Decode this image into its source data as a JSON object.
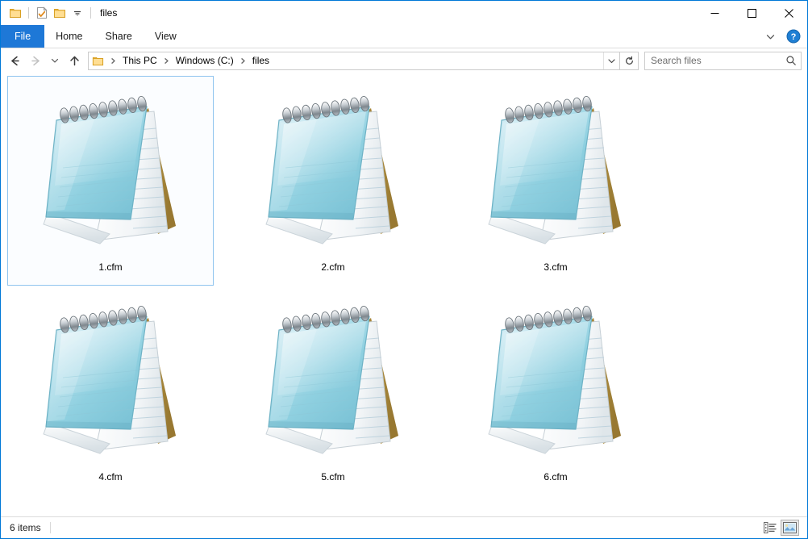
{
  "window": {
    "title": "files",
    "accent_color": "#0078d7"
  },
  "quick_access": {
    "items": [
      {
        "name": "folder-icon",
        "label": "Folder"
      },
      {
        "name": "properties-icon",
        "label": "Properties"
      },
      {
        "name": "new-folder-icon",
        "label": "New folder"
      },
      {
        "name": "chevron-down-icon",
        "label": "Customize Quick Access Toolbar"
      }
    ]
  },
  "window_controls": {
    "minimize": "—",
    "maximize": "□",
    "close": "✕"
  },
  "ribbon": {
    "tabs": [
      {
        "label": "File",
        "active": true
      },
      {
        "label": "Home",
        "active": false
      },
      {
        "label": "Share",
        "active": false
      },
      {
        "label": "View",
        "active": false
      }
    ],
    "file_tab_color": "#1e78d7",
    "expand_icon": "chevron-down-icon",
    "help_icon": "help-icon",
    "help_glyph": "?"
  },
  "navigation": {
    "back": {
      "name": "back-arrow-icon",
      "enabled": true
    },
    "forward": {
      "name": "forward-arrow-icon",
      "enabled": false
    },
    "recent": {
      "name": "chevron-down-icon",
      "enabled": true
    },
    "up": {
      "name": "up-arrow-icon",
      "enabled": true
    },
    "breadcrumbs": [
      {
        "label": "This PC"
      },
      {
        "label": "Windows (C:)"
      },
      {
        "label": "files"
      }
    ],
    "breadcrumb_dropdown": "chevron-down-icon",
    "refresh": {
      "name": "refresh-icon",
      "glyph": "↺"
    }
  },
  "search": {
    "placeholder": "Search files",
    "value": "",
    "icon": "search-icon"
  },
  "files": [
    {
      "label": "1.cfm",
      "icon": "notepad-file-icon",
      "selected": true
    },
    {
      "label": "2.cfm",
      "icon": "notepad-file-icon",
      "selected": false
    },
    {
      "label": "3.cfm",
      "icon": "notepad-file-icon",
      "selected": false
    },
    {
      "label": "4.cfm",
      "icon": "notepad-file-icon",
      "selected": false
    },
    {
      "label": "5.cfm",
      "icon": "notepad-file-icon",
      "selected": false
    },
    {
      "label": "6.cfm",
      "icon": "notepad-file-icon",
      "selected": false
    }
  ],
  "status": {
    "item_count_text": "6 items",
    "views": [
      {
        "name": "details-view-button",
        "active": false
      },
      {
        "name": "large-icons-view-button",
        "active": true
      }
    ]
  }
}
